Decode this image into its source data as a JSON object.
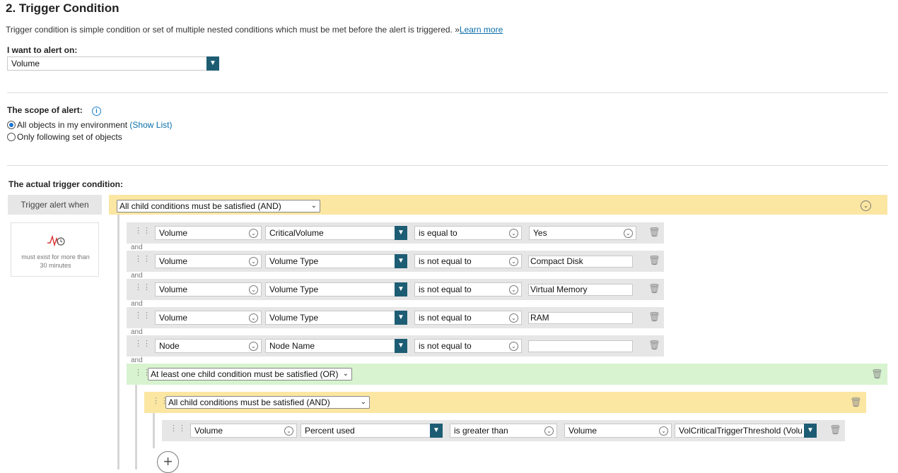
{
  "section": {
    "title": "2. Trigger Condition",
    "description": "Trigger condition is simple condition or set of multiple nested conditions which must be met before the alert is triggered. »",
    "learn_more": "Learn more"
  },
  "alert_on": {
    "label": "I want to alert on:",
    "value": "Volume"
  },
  "scope": {
    "label": "The scope of alert:",
    "option_all": "All objects in my environment",
    "show_list": "(Show List)",
    "option_following": "Only following set of objects",
    "selected": "all"
  },
  "trigger": {
    "label": "The actual trigger condition:",
    "when_label": "Trigger alert when",
    "duration_text": "must exist for more than 30 minutes",
    "group_root": "All child conditions must be satisfied (AND)",
    "and_word": "and",
    "rows": [
      {
        "object": "Volume",
        "field": "CriticalVolume",
        "operator": "is equal to",
        "value": "Yes"
      },
      {
        "object": "Volume",
        "field": "Volume Type",
        "operator": "is not equal to",
        "value": "Compact Disk"
      },
      {
        "object": "Volume",
        "field": "Volume Type",
        "operator": "is not equal to",
        "value": "Virtual Memory"
      },
      {
        "object": "Volume",
        "field": "Volume Type",
        "operator": "is not equal to",
        "value": "RAM"
      },
      {
        "object": "Node",
        "field": "Node Name",
        "operator": "is not equal to",
        "value": ""
      }
    ],
    "group_or": "At least one child condition must be satisfied (OR)",
    "group_and_nested": "All child conditions must be satisfied (AND)",
    "nested_row": {
      "object": "Volume",
      "field": "Percent used",
      "operator": "is greater than",
      "compare_object": "Volume",
      "value": "VolCriticalTriggerThreshold (Volu"
    }
  },
  "colors": {
    "accent": "#1d5d74",
    "and_group": "#fbe6a2",
    "or_group": "#d7f3cf",
    "link": "#0a6ea8"
  }
}
